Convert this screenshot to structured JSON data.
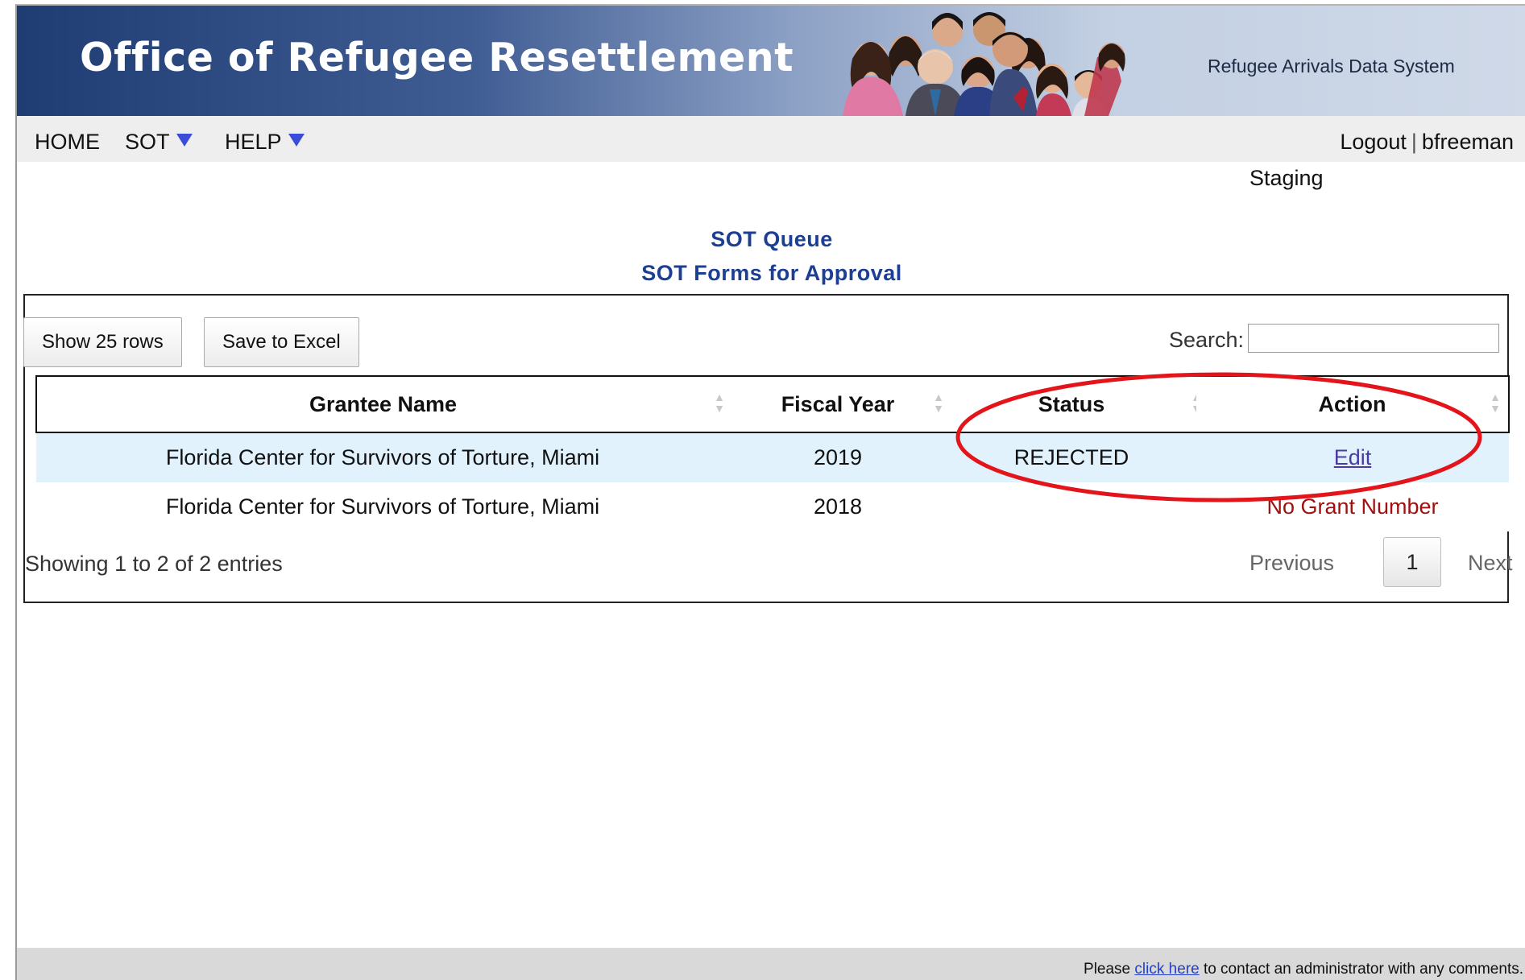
{
  "header": {
    "title": "Office of Refugee Resettlement",
    "subtitle": "Refugee Arrivals Data System"
  },
  "nav": {
    "home": "HOME",
    "sot": "SOT",
    "help": "HELP",
    "logout": "Logout",
    "separator": "|",
    "username": "bfreeman",
    "environment": "Staging"
  },
  "page": {
    "title": "SOT Queue",
    "subtitle": "SOT Forms for Approval"
  },
  "toolbar": {
    "show_rows_label": "Show 25 rows",
    "save_excel_label": "Save to Excel",
    "search_label": "Search:",
    "search_value": ""
  },
  "table": {
    "columns": [
      "Grantee Name",
      "Fiscal Year",
      "Status",
      "Action"
    ],
    "rows": [
      {
        "grantee": "Florida Center for Survivors of Torture, Miami",
        "fiscal_year": "2019",
        "status": "REJECTED",
        "action": "Edit"
      },
      {
        "grantee": "Florida Center for Survivors of Torture, Miami",
        "fiscal_year": "2018",
        "status": "",
        "action": "No Grant Number"
      }
    ]
  },
  "pagination": {
    "info": "Showing 1 to 2 of 2 entries",
    "previous": "Previous",
    "current_page": "1",
    "next": "Next"
  },
  "footer": {
    "prefix": "Please",
    "link": "click here",
    "suffix": "to contact an administrator with any comments."
  },
  "colors": {
    "banner_dark": "#1f3c73",
    "heading_blue": "#1c3f94",
    "row_highlight": "#e1f2fd",
    "nav_arrow": "#3a4cd8",
    "annotation_red": "#e3141a",
    "warning_red": "#a01010"
  },
  "icons": [
    "dropdown-arrow-icon",
    "sort-arrows-icon",
    "banner-family-photo"
  ]
}
